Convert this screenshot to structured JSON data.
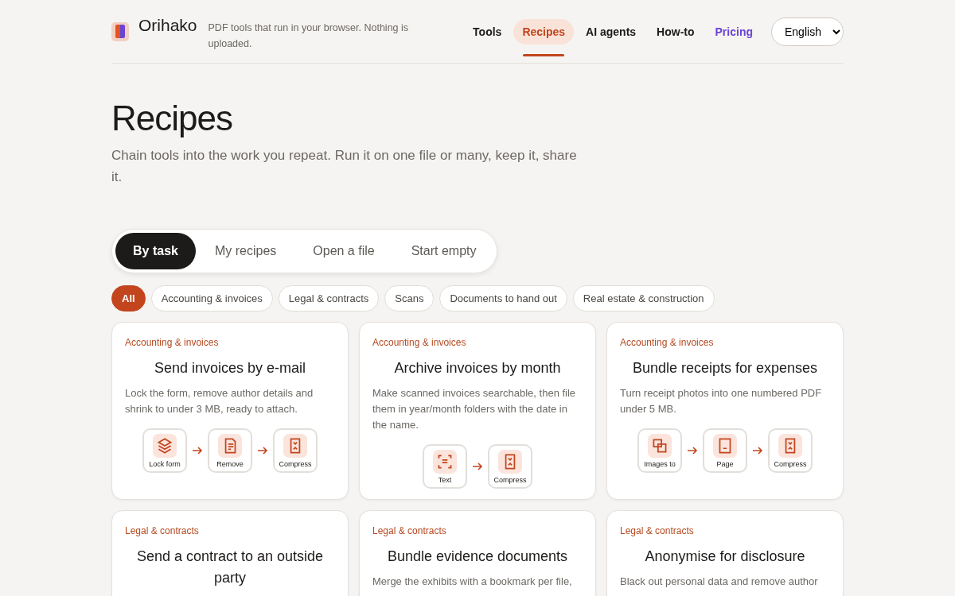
{
  "brand": {
    "name": "Orihako",
    "tagline": "PDF tools that run in your browser. Nothing is uploaded."
  },
  "nav": [
    {
      "label": "Tools",
      "selected": false,
      "kind": "link"
    },
    {
      "label": "Recipes",
      "selected": true,
      "kind": "link"
    },
    {
      "label": "AI agents",
      "selected": false,
      "kind": "link"
    },
    {
      "label": "How-to",
      "selected": false,
      "kind": "link"
    },
    {
      "label": "Pricing",
      "selected": false,
      "kind": "accent"
    }
  ],
  "language": "English",
  "page": {
    "title": "Recipes",
    "subtitle": "Chain tools into the work you repeat. Run it on one file or many, keep it, share it."
  },
  "modes": [
    {
      "label": "By task",
      "selected": true
    },
    {
      "label": "My recipes",
      "selected": false
    },
    {
      "label": "Open a file",
      "selected": false
    },
    {
      "label": "Start empty",
      "selected": false
    }
  ],
  "filters": [
    {
      "label": "All",
      "selected": true
    },
    {
      "label": "Accounting & invoices",
      "selected": false
    },
    {
      "label": "Legal & contracts",
      "selected": false
    },
    {
      "label": "Scans",
      "selected": false
    },
    {
      "label": "Documents to hand out",
      "selected": false
    },
    {
      "label": "Real estate & construction",
      "selected": false
    }
  ],
  "recipes": [
    {
      "category": "Accounting & invoices",
      "title": "Send invoices by e-mail",
      "description": "Lock the form, remove author details and shrink to under 3 MB, ready to attach.",
      "steps": [
        {
          "label": "Lock form",
          "kind": "layers"
        },
        {
          "label": "Remove",
          "kind": "doc"
        },
        {
          "label": "Compress",
          "kind": "compress"
        }
      ]
    },
    {
      "category": "Accounting & invoices",
      "title": "Archive invoices by month",
      "description": "Make scanned invoices searchable, then file them in year/month folders with the date in the name.",
      "steps": [
        {
          "label": "Text",
          "kind": "scan"
        },
        {
          "label": "Compress",
          "kind": "compress"
        }
      ]
    },
    {
      "category": "Accounting & invoices",
      "title": "Bundle receipts for expenses",
      "description": "Turn receipt photos into one numbered PDF under 5 MB.",
      "steps": [
        {
          "label": "Images to",
          "kind": "images"
        },
        {
          "label": "Page",
          "kind": "page"
        },
        {
          "label": "Compress",
          "kind": "compress"
        }
      ]
    },
    {
      "category": "Legal & contracts",
      "title": "Send a contract to an outside party"
    },
    {
      "category": "Legal & contracts",
      "title": "Bundle evidence documents",
      "description": "Merge the exhibits with a bookmark per file,"
    },
    {
      "category": "Legal & contracts",
      "title": "Anonymise for disclosure",
      "description": "Black out personal data and remove author"
    }
  ]
}
